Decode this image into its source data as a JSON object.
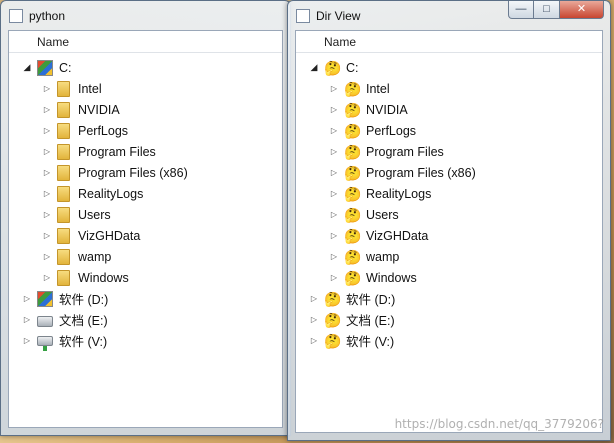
{
  "windows": [
    {
      "id": "python",
      "title": "python",
      "header": "Name",
      "icon_style": "folder",
      "tree": [
        {
          "label": "C:",
          "level": 0,
          "expanded": true,
          "icon": "windows-drive-icon"
        },
        {
          "label": "Intel",
          "level": 1,
          "expanded": false,
          "icon": "folder-icon"
        },
        {
          "label": "NVIDIA",
          "level": 1,
          "expanded": false,
          "icon": "folder-icon"
        },
        {
          "label": "PerfLogs",
          "level": 1,
          "expanded": false,
          "icon": "folder-icon"
        },
        {
          "label": "Program Files",
          "level": 1,
          "expanded": false,
          "icon": "folder-icon"
        },
        {
          "label": "Program Files (x86)",
          "level": 1,
          "expanded": false,
          "icon": "folder-icon"
        },
        {
          "label": "RealityLogs",
          "level": 1,
          "expanded": false,
          "icon": "folder-icon"
        },
        {
          "label": "Users",
          "level": 1,
          "expanded": false,
          "icon": "folder-icon"
        },
        {
          "label": "VizGHData",
          "level": 1,
          "expanded": false,
          "icon": "folder-icon"
        },
        {
          "label": "wamp",
          "level": 1,
          "expanded": false,
          "icon": "folder-icon"
        },
        {
          "label": "Windows",
          "level": 1,
          "expanded": false,
          "icon": "folder-icon"
        },
        {
          "label": "软件 (D:)",
          "level": 0,
          "expanded": false,
          "icon": "windows-drive-icon"
        },
        {
          "label": "文档 (E:)",
          "level": 0,
          "expanded": false,
          "icon": "drive-icon"
        },
        {
          "label": "软件 (V:)",
          "level": 0,
          "expanded": false,
          "icon": "network-drive-icon"
        }
      ]
    },
    {
      "id": "dirview",
      "title": "Dir View",
      "header": "Name",
      "icon_style": "thinking",
      "tree": [
        {
          "label": "C:",
          "level": 0,
          "expanded": true,
          "icon": "thinking-face-icon"
        },
        {
          "label": "Intel",
          "level": 1,
          "expanded": false,
          "icon": "thinking-face-icon"
        },
        {
          "label": "NVIDIA",
          "level": 1,
          "expanded": false,
          "icon": "thinking-face-icon"
        },
        {
          "label": "PerfLogs",
          "level": 1,
          "expanded": false,
          "icon": "thinking-face-icon"
        },
        {
          "label": "Program Files",
          "level": 1,
          "expanded": false,
          "icon": "thinking-face-icon"
        },
        {
          "label": "Program Files (x86)",
          "level": 1,
          "expanded": false,
          "icon": "thinking-face-icon"
        },
        {
          "label": "RealityLogs",
          "level": 1,
          "expanded": false,
          "icon": "thinking-face-icon"
        },
        {
          "label": "Users",
          "level": 1,
          "expanded": false,
          "icon": "thinking-face-icon"
        },
        {
          "label": "VizGHData",
          "level": 1,
          "expanded": false,
          "icon": "thinking-face-icon"
        },
        {
          "label": "wamp",
          "level": 1,
          "expanded": false,
          "icon": "thinking-face-icon"
        },
        {
          "label": "Windows",
          "level": 1,
          "expanded": false,
          "icon": "thinking-face-icon"
        },
        {
          "label": "软件 (D:)",
          "level": 0,
          "expanded": false,
          "icon": "thinking-face-icon"
        },
        {
          "label": "文档 (E:)",
          "level": 0,
          "expanded": false,
          "icon": "thinking-face-icon"
        },
        {
          "label": "软件 (V:)",
          "level": 0,
          "expanded": false,
          "icon": "thinking-face-icon"
        }
      ]
    }
  ],
  "watermark": "https://blog.csdn.net/qq_3779206?"
}
